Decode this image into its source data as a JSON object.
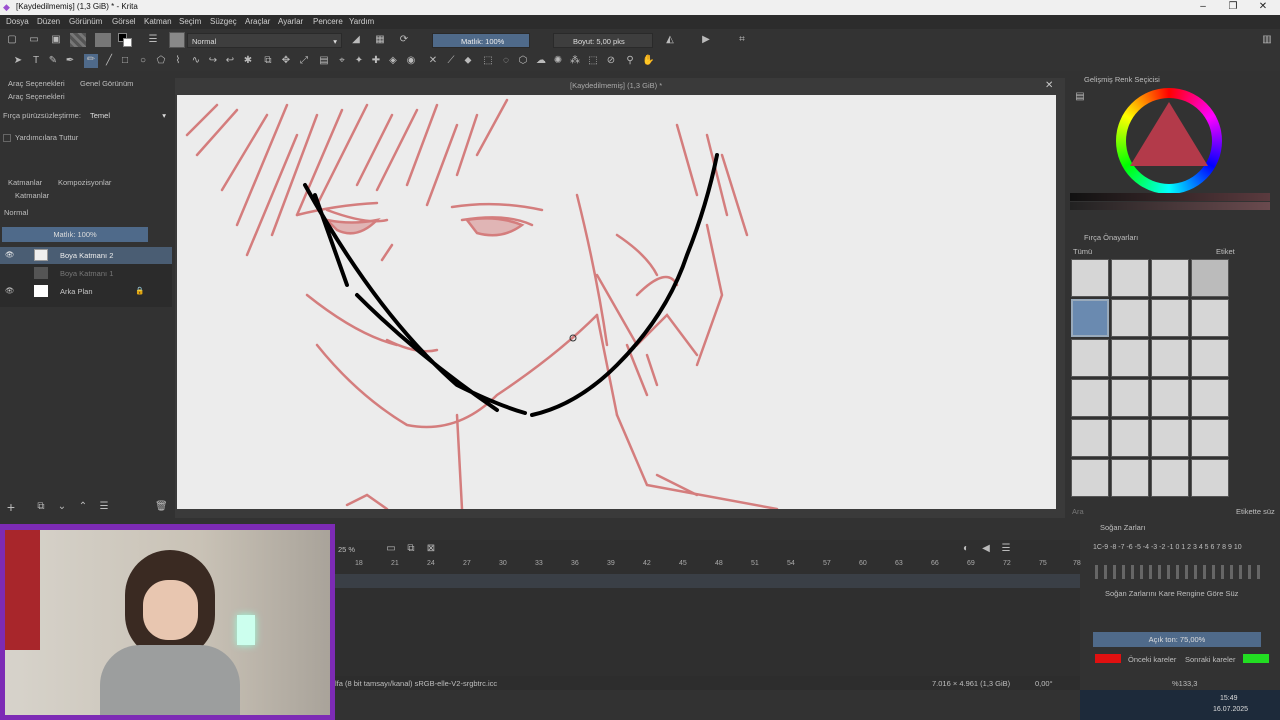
{
  "title": "[Kaydedilmemiş]  (1,3 GiB) * - Krita",
  "menu": [
    "Dosya",
    "Düzen",
    "Görünüm",
    "Görsel",
    "Katman",
    "Seçim",
    "Süzgeç",
    "Araçlar",
    "Ayarlar",
    "Pencere",
    "Yardım"
  ],
  "toolbar": {
    "blend_mode": "Normal",
    "opacity": "Matlık: 100%",
    "size": "Boyut: 5,00 pks"
  },
  "left_panel": {
    "tabs": [
      "Araç Seçenekleri",
      "Genel Görünüm"
    ],
    "tool_options_title": "Araç Seçenekleri",
    "smoothing_label": "Fırça pürüzsüzleştirme:",
    "smoothing_value": "Temel",
    "assist_label": "Yardımcılara Tuttur",
    "layer_tabs": [
      "Katmanlar",
      "Kompozisyonlar"
    ],
    "layers_title": "Katmanlar",
    "blend": "Normal",
    "opacity": "Matlık:  100%",
    "layers": [
      {
        "name": "Boya Katmanı 2",
        "active": true
      },
      {
        "name": "Boya Katmanı 1",
        "active": false
      },
      {
        "name": "Arka Plan",
        "active": false
      }
    ]
  },
  "canvas_title": "[Kaydedilmemiş]  (1,3 GiB) *",
  "right_panel": {
    "color_title": "Gelişmiş Renk Seçicisi",
    "brush_title": "Fırça Önayarları",
    "brush_filter": "Tümü",
    "tag_label": "Etiket",
    "search_placeholder": "Ara",
    "tag_filter": "Etikette süz",
    "onion_title": "Soğan Zarları",
    "onion_numbers": "1C-9 -8 -7 -6 -5 -4 -3 -2 -1  0  1 2 3 4 5 6 7 8 9 10",
    "onion_checkbox": "Soğan Zarlarını Kare Rengine Göre Süz",
    "onion_opacity": "Açık ton: 75,00%",
    "prev_frames": "Önceki kareler",
    "next_frames": "Sonraki kareler",
    "prev_color": "#e01010",
    "next_color": "#22dd22"
  },
  "timeline": {
    "zoom": "25 %",
    "frames": [
      "18",
      "21",
      "24",
      "27",
      "30",
      "33",
      "36",
      "39",
      "42",
      "45",
      "48",
      "51",
      "54",
      "57",
      "60",
      "63",
      "66",
      "69",
      "72",
      "75",
      "78"
    ]
  },
  "status": {
    "profile": "lfa (8 bit tamsayı/kanal) sRGB-elle-V2-srgbtrc.icc",
    "dims": "7.016 × 4.961 (1,3 GiB)",
    "rotation": "0,00°",
    "zoom": "%133,3"
  },
  "clock": {
    "time": "15:49",
    "date": "16.07.2025"
  }
}
